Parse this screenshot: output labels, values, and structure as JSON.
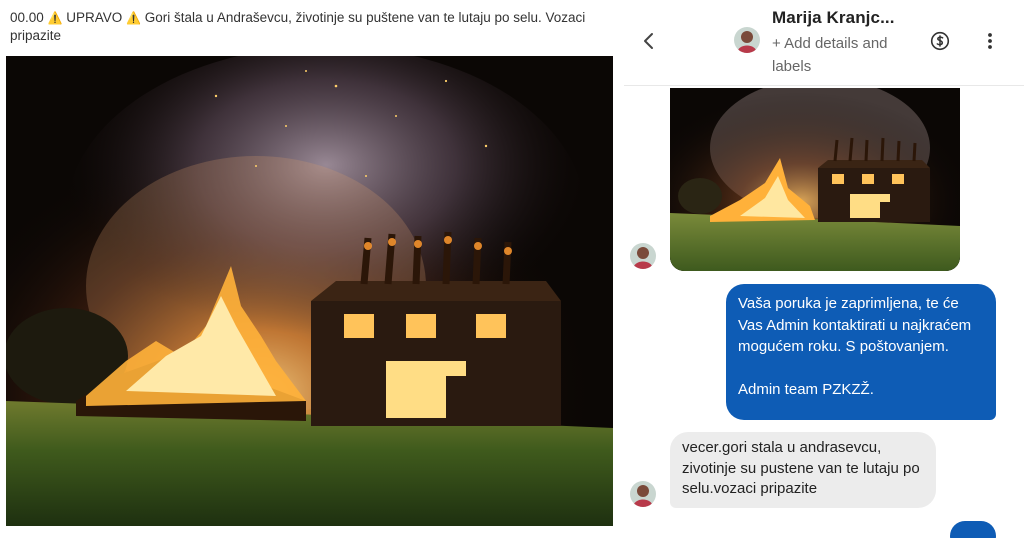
{
  "post": {
    "time": "00.00",
    "flag_left": "UPRAVO",
    "warn_icon": "⚠️",
    "text": "Gori štala u Andraševcu, životinje su puštene van te lutaju po selu. Vozaci pripazite"
  },
  "chat": {
    "contact_name": "Marija Kranjc...",
    "add_details": "+ Add details and labels",
    "icons": [
      "chevron-left-icon",
      "dollar-circle-icon",
      "more-vertical-icon"
    ],
    "outgoing_message": {
      "line1": "Vaša poruka je zaprimljena, te će Vas Admin kontaktirati u najkraćem mogućem roku. S poštovanjem.",
      "signature": "Admin team PZKZŽ."
    },
    "incoming_message": "vecer.gori stala u andrasevcu, zivotinje su pustene van te lutaju po selu.vozaci pripazite"
  },
  "colors": {
    "outgoing_bubble": "#0e5cb5",
    "incoming_bubble": "#ececec",
    "warning": "#e6a400"
  }
}
